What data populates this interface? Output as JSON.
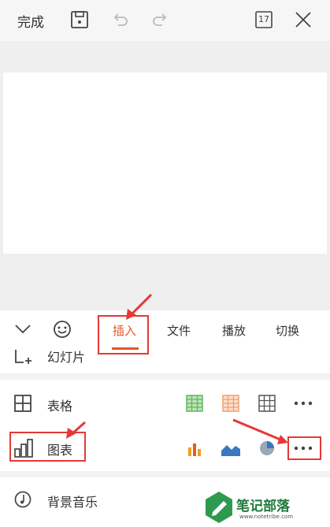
{
  "toolbar": {
    "done_label": "完成",
    "calendar_day": "17"
  },
  "tabs": {
    "insert": "插入",
    "file": "文件",
    "play": "播放",
    "switch": "切换"
  },
  "menu": {
    "slide_label": "幻灯片",
    "table_label": "表格",
    "chart_label": "图表",
    "music_label": "背景音乐"
  },
  "colors": {
    "accent": "#e5562b",
    "annotation": "#e53935",
    "table_green": "#5cb85c",
    "table_orange": "#f0a070",
    "chart_blue": "#3a78c3",
    "chart_orange": "#f0a020"
  },
  "watermark": {
    "title": "笔记部落",
    "url": "www.notetribe.com"
  }
}
